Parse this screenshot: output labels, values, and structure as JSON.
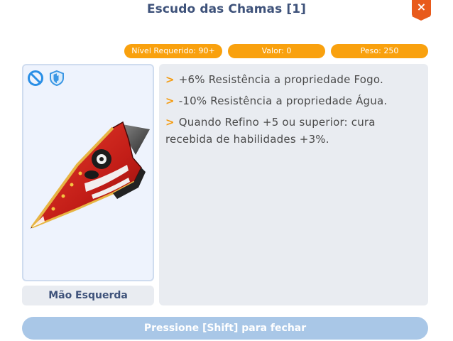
{
  "window": {
    "title": "Escudo das Chamas [1]",
    "close_label": "×"
  },
  "stats": {
    "level": "Nível Requerido: 90+",
    "value": "Valor: 0",
    "weight": "Peso: 250"
  },
  "item": {
    "icons": [
      "no-refine-icon",
      "shield-icon"
    ],
    "slot": "Mão Esquerda"
  },
  "description": {
    "bullet": ">",
    "lines": [
      "+6% Resistência a propriedade Fogo.",
      "-10% Resistência a propriedade Água.",
      "Quando Refino +5 ou superior: cura recebida de habilidades +3%."
    ]
  },
  "footer": {
    "label": "Pressione [Shift] para fechar"
  },
  "colors": {
    "accent": "#f9a10e",
    "close": "#e85a1b",
    "title": "#3e527a",
    "footer": "#a9c7e7"
  }
}
